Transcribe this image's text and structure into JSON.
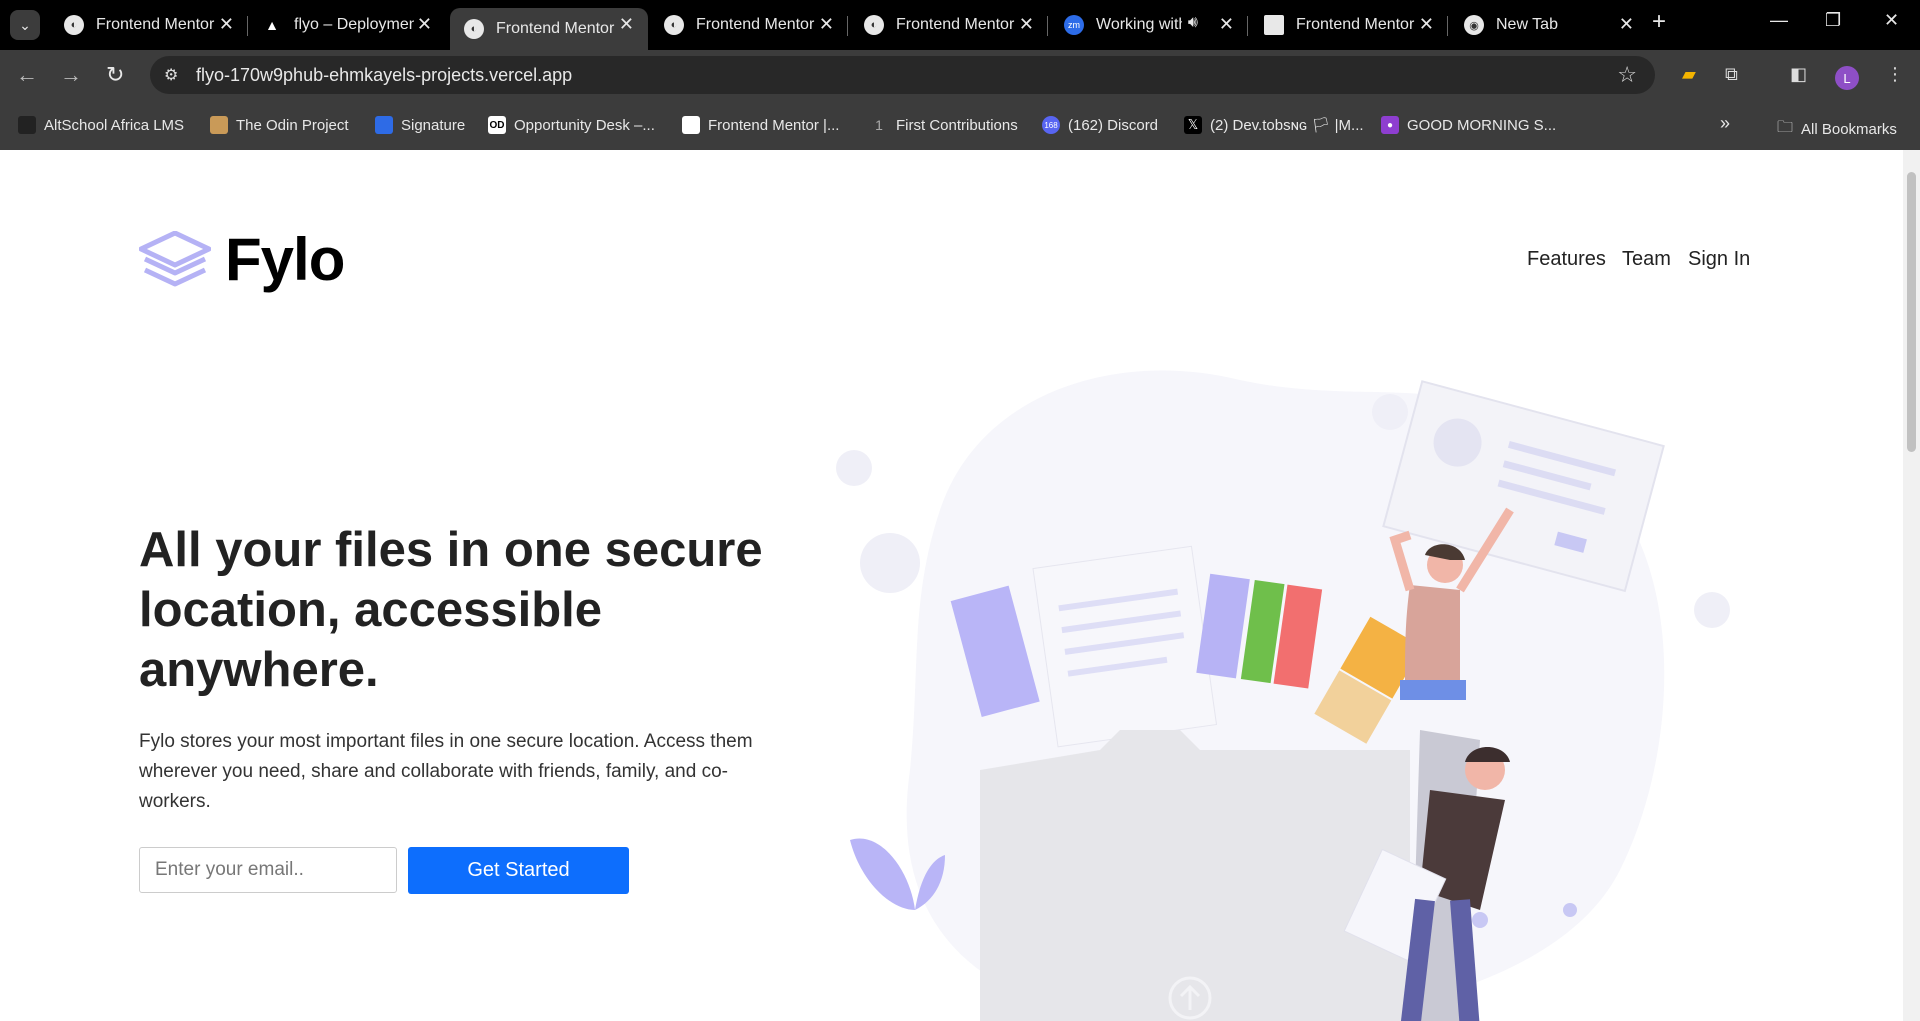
{
  "browser": {
    "tabs": [
      {
        "title": "Frontend Mentor",
        "active": false
      },
      {
        "title": "flyo – Deployments",
        "active": false
      },
      {
        "title": "Frontend Mentor",
        "active": true
      },
      {
        "title": "Frontend Mentor",
        "active": false
      },
      {
        "title": "Frontend Mentor",
        "active": false
      },
      {
        "title": "Working with",
        "active": false
      },
      {
        "title": "Frontend Mentor",
        "active": false
      },
      {
        "title": "New Tab",
        "active": false
      }
    ],
    "url": "flyo-170w9phub-ehmkayels-projects.vercel.app",
    "profile_initial": "L",
    "bookmarks": [
      "AltSchool Africa LMS",
      "The Odin Project",
      "Signature",
      "Opportunity Desk –...",
      "Frontend Mentor |...",
      "First Contributions",
      "(162) Discord",
      "(2) Dev.tobsɴɢ 🏳 |M...",
      "GOOD MORNING S..."
    ],
    "bookmark_badge": "168",
    "all_bookmarks": "All Bookmarks"
  },
  "page": {
    "brand": "Fylo",
    "nav": {
      "features": "Features",
      "team": "Team",
      "signin": "Sign In"
    },
    "hero": {
      "title": "All your files in one secure location, accessible anywhere.",
      "description": "Fylo stores your most important files in one secure location. Access them wherever you need, share and collaborate with friends, family, and co-workers.",
      "email_placeholder": "Enter your email..",
      "cta": "Get Started"
    }
  },
  "colors": {
    "accent": "#0d6efd",
    "logo": "#b5b2f5",
    "text": "#222222"
  }
}
